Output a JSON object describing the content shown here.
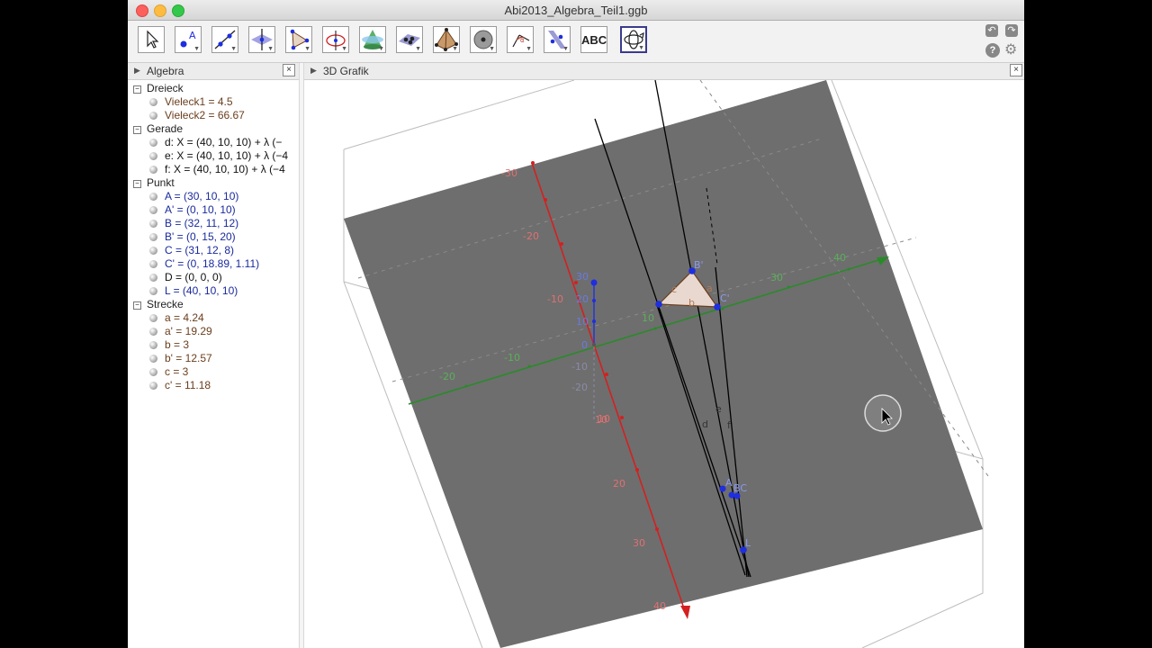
{
  "window": {
    "title": "Abi2013_Algebra_Teil1.ggb"
  },
  "toolbar": {
    "text_tool_label": "ABC",
    "tools": [
      {
        "name": "move-tool-icon"
      },
      {
        "name": "point-tool-icon"
      },
      {
        "name": "line-tool-icon"
      },
      {
        "name": "perpendicular-line-tool-icon"
      },
      {
        "name": "polygon-tool-icon"
      },
      {
        "name": "circle-tool-icon"
      },
      {
        "name": "cone-intersect-tool-icon"
      },
      {
        "name": "plane-tool-icon"
      },
      {
        "name": "pyramid-tool-icon"
      },
      {
        "name": "sphere-tool-icon"
      },
      {
        "name": "angle-tool-icon"
      },
      {
        "name": "reflect-tool-icon"
      },
      {
        "name": "text-tool-icon"
      },
      {
        "name": "rotate-view-tool-icon"
      }
    ]
  },
  "algebra": {
    "title": "Algebra",
    "groups": [
      {
        "name": "Dreieck",
        "items": [
          {
            "text": "Vieleck1 = 4.5",
            "color": "brown"
          },
          {
            "text": "Vieleck2 = 66.67",
            "color": "brown"
          }
        ]
      },
      {
        "name": "Gerade",
        "items": [
          {
            "text": "d: X = (40, 10, 10) + λ (−",
            "color": "black"
          },
          {
            "text": "e: X = (40, 10, 10) + λ (−4",
            "color": "black"
          },
          {
            "text": "f: X = (40, 10, 10) + λ (−4",
            "color": "black"
          }
        ]
      },
      {
        "name": "Punkt",
        "items": [
          {
            "text": "A = (30, 10, 10)",
            "color": "blue"
          },
          {
            "text": "A' = (0, 10, 10)",
            "color": "blue"
          },
          {
            "text": "B = (32, 11, 12)",
            "color": "blue"
          },
          {
            "text": "B' = (0, 15, 20)",
            "color": "blue"
          },
          {
            "text": "C = (31, 12, 8)",
            "color": "blue"
          },
          {
            "text": "C' = (0, 18.89, 1.11)",
            "color": "blue"
          },
          {
            "text": "D = (0, 0, 0)",
            "color": "black"
          },
          {
            "text": "L = (40, 10, 10)",
            "color": "blue"
          }
        ]
      },
      {
        "name": "Strecke",
        "items": [
          {
            "text": "a = 4.24",
            "color": "brown"
          },
          {
            "text": "a' = 19.29",
            "color": "brown"
          },
          {
            "text": "b = 3",
            "color": "brown"
          },
          {
            "text": "b' = 12.57",
            "color": "brown"
          },
          {
            "text": "c = 3",
            "color": "brown"
          },
          {
            "text": "c' = 11.18",
            "color": "brown"
          }
        ]
      }
    ]
  },
  "view3d": {
    "title": "3D Grafik",
    "x_axis_labels": [
      "-30",
      "-20",
      "-10",
      "10",
      "20",
      "30",
      "40"
    ],
    "y_axis_labels": [
      "-20",
      "-10",
      "10",
      "30",
      "40"
    ],
    "z_axis_labels": [
      "30",
      "20",
      "10",
      "0",
      "-10",
      "-20",
      "10"
    ],
    "point_labels": {
      "b_prime": "B'",
      "c_prime": "C'",
      "a": "A",
      "bc": "BC",
      "l": "L",
      "seg_b": "b",
      "seg_a": "a",
      "seg_c": "c",
      "line_d": "d",
      "line_e": "e",
      "line_f": "f"
    },
    "colors": {
      "plane": "#6e6e6e",
      "x_axis": "#d42020",
      "y_axis": "#2a8a2a",
      "z_axis": "#2a3ad0",
      "point": "#1e2ee0"
    }
  }
}
